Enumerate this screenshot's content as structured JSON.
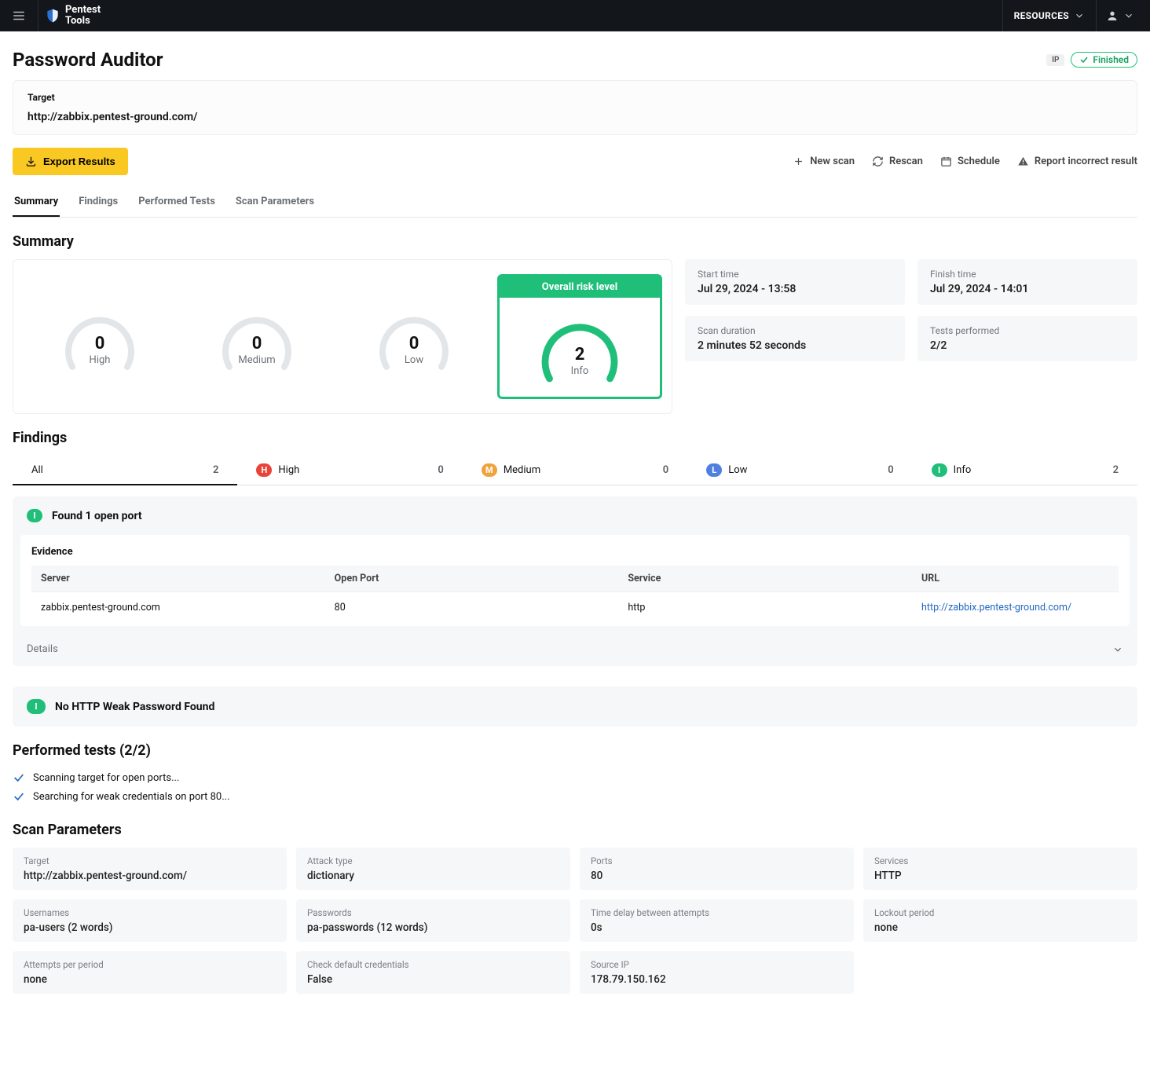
{
  "topbar": {
    "brand_line1": "Pentest",
    "brand_line2": "Tools",
    "resources_label": "RESOURCES"
  },
  "header": {
    "title": "Password Auditor",
    "ip_badge": "IP",
    "status_label": "Finished"
  },
  "target": {
    "label": "Target",
    "value": "http://zabbix.pentest-ground.com/"
  },
  "actions": {
    "export": "Export Results",
    "new_scan": "New scan",
    "rescan": "Rescan",
    "schedule": "Schedule",
    "report_incorrect": "Report incorrect result"
  },
  "tabs": {
    "summary": "Summary",
    "findings": "Findings",
    "performed": "Performed Tests",
    "params": "Scan Parameters"
  },
  "summary": {
    "heading": "Summary",
    "gauges": {
      "high": {
        "value": "0",
        "label": "High"
      },
      "medium": {
        "value": "0",
        "label": "Medium"
      },
      "low": {
        "value": "0",
        "label": "Low"
      },
      "info": {
        "value": "2",
        "label": "Info"
      }
    },
    "overall_label": "Overall risk level",
    "meta": {
      "start_label": "Start time",
      "start_value": "Jul 29, 2024 - 13:58",
      "finish_label": "Finish time",
      "finish_value": "Jul 29, 2024 - 14:01",
      "duration_label": "Scan duration",
      "duration_value": "2 minutes 52 seconds",
      "tests_label": "Tests performed",
      "tests_value": "2/2"
    }
  },
  "findings": {
    "heading": "Findings",
    "filters": {
      "all": {
        "label": "All",
        "count": "2"
      },
      "high": {
        "label": "High",
        "count": "0"
      },
      "medium": {
        "label": "Medium",
        "count": "0"
      },
      "low": {
        "label": "Low",
        "count": "0"
      },
      "info": {
        "label": "Info",
        "count": "2"
      }
    },
    "items": [
      {
        "severity": "I",
        "title": "Found 1 open port",
        "evidence_label": "Evidence",
        "columns": {
          "server": "Server",
          "port": "Open Port",
          "service": "Service",
          "url": "URL"
        },
        "row": {
          "server": "zabbix.pentest-ground.com",
          "port": "80",
          "service": "http",
          "url": "http://zabbix.pentest-ground.com/"
        },
        "details_label": "Details"
      },
      {
        "severity": "I",
        "title": "No HTTP Weak Password Found"
      }
    ]
  },
  "performed": {
    "heading": "Performed tests (2/2)",
    "tests": {
      "t1": "Scanning target for open ports...",
      "t2": "Searching for weak credentials on port 80..."
    }
  },
  "params": {
    "heading": "Scan Parameters",
    "items": {
      "target": {
        "label": "Target",
        "value": "http://zabbix.pentest-ground.com/"
      },
      "attack": {
        "label": "Attack type",
        "value": "dictionary"
      },
      "ports": {
        "label": "Ports",
        "value": "80"
      },
      "services": {
        "label": "Services",
        "value": "HTTP"
      },
      "usernames": {
        "label": "Usernames",
        "value": "pa-users (2 words)"
      },
      "passwords": {
        "label": "Passwords",
        "value": "pa-passwords (12 words)"
      },
      "delay": {
        "label": "Time delay between attempts",
        "value": "0s"
      },
      "lockout": {
        "label": "Lockout period",
        "value": "none"
      },
      "attempts": {
        "label": "Attempts per period",
        "value": "none"
      },
      "checkdef": {
        "label": "Check default credentials",
        "value": "False"
      },
      "sourceip": {
        "label": "Source IP",
        "value": "178.79.150.162"
      }
    }
  }
}
